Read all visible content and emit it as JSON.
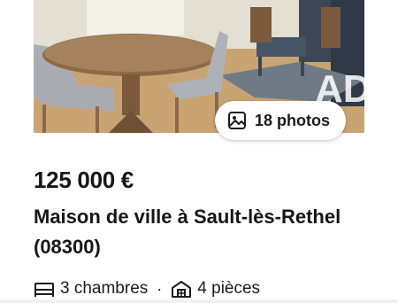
{
  "listing": {
    "photo": {
      "icon": "photo-gallery-icon",
      "count_label": "18 photos",
      "watermark": "iAD"
    },
    "price": "125 000 €",
    "title": "Maison de ville à Sault-lès-Rethel (08300)",
    "features": [
      {
        "icon": "bed-icon",
        "label": "3 chambres"
      },
      {
        "icon": "house-icon",
        "label": "4 pièces"
      }
    ],
    "separator": "·"
  },
  "colors": {
    "text": "#161616",
    "badge_bg": "#ffffff"
  }
}
